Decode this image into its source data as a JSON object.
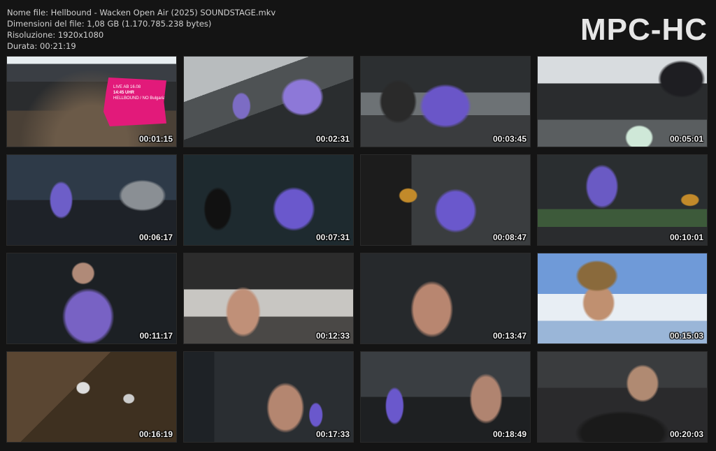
{
  "info": {
    "file_name": "Nome file: Hellbound - Wacken Open Air (2025) SOUNDSTAGE.mkv",
    "file_size": "Dimensioni del file: 1,08 GB (1.170.785.238 bytes)",
    "resolution": "Risoluzione: 1920x1080",
    "duration": "Durata: 00:21:19"
  },
  "brand": "MPC-HC",
  "thumbnails": [
    {
      "timestamp": "00:01:15",
      "promo": [
        "LIVE AB 16.08",
        "14:45 UHR",
        "HELLBOUND / NO Bulgaria"
      ]
    },
    {
      "timestamp": "00:02:31"
    },
    {
      "timestamp": "00:03:45"
    },
    {
      "timestamp": "00:05:01"
    },
    {
      "timestamp": "00:06:17"
    },
    {
      "timestamp": "00:07:31"
    },
    {
      "timestamp": "00:08:47"
    },
    {
      "timestamp": "00:10:01"
    },
    {
      "timestamp": "00:11:17"
    },
    {
      "timestamp": "00:12:33"
    },
    {
      "timestamp": "00:13:47"
    },
    {
      "timestamp": "00:15:03"
    },
    {
      "timestamp": "00:16:19"
    },
    {
      "timestamp": "00:17:33"
    },
    {
      "timestamp": "00:18:49"
    },
    {
      "timestamp": "00:20:03"
    }
  ]
}
